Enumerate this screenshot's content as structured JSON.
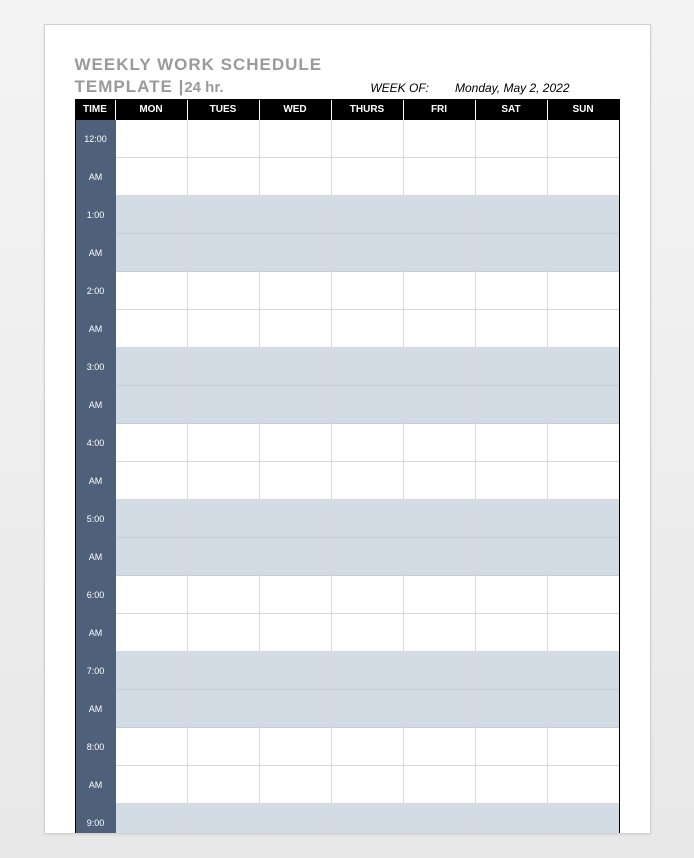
{
  "title": {
    "line1": "WEEKLY WORK SCHEDULE",
    "line2_prefix": "TEMPLATE |",
    "line2_suffix": "24 hr."
  },
  "week_of_label": "WEEK OF:",
  "week_of_value": "Monday, May 2, 2022",
  "columns": {
    "time": "TIME",
    "days": [
      "MON",
      "TUES",
      "WED",
      "THURS",
      "FRI",
      "SAT",
      "SUN"
    ]
  },
  "rows": [
    {
      "top": "12:00",
      "bottom": "",
      "shaded": false
    },
    {
      "top": "AM",
      "bottom": "",
      "shaded": false
    },
    {
      "top": "1:00",
      "bottom": "",
      "shaded": true
    },
    {
      "top": "AM",
      "bottom": "",
      "shaded": true
    },
    {
      "top": "2:00",
      "bottom": "",
      "shaded": false
    },
    {
      "top": "AM",
      "bottom": "",
      "shaded": false
    },
    {
      "top": "3:00",
      "bottom": "",
      "shaded": true
    },
    {
      "top": "AM",
      "bottom": "",
      "shaded": true
    },
    {
      "top": "4:00",
      "bottom": "",
      "shaded": false
    },
    {
      "top": "AM",
      "bottom": "",
      "shaded": false
    },
    {
      "top": "5:00",
      "bottom": "",
      "shaded": true
    },
    {
      "top": "AM",
      "bottom": "",
      "shaded": true
    },
    {
      "top": "6:00",
      "bottom": "",
      "shaded": false
    },
    {
      "top": "AM",
      "bottom": "",
      "shaded": false
    },
    {
      "top": "7:00",
      "bottom": "",
      "shaded": true
    },
    {
      "top": "AM",
      "bottom": "",
      "shaded": true
    },
    {
      "top": "8:00",
      "bottom": "",
      "shaded": false
    },
    {
      "top": "AM",
      "bottom": "",
      "shaded": false
    },
    {
      "top": "9:00",
      "bottom": "",
      "shaded": true
    }
  ]
}
